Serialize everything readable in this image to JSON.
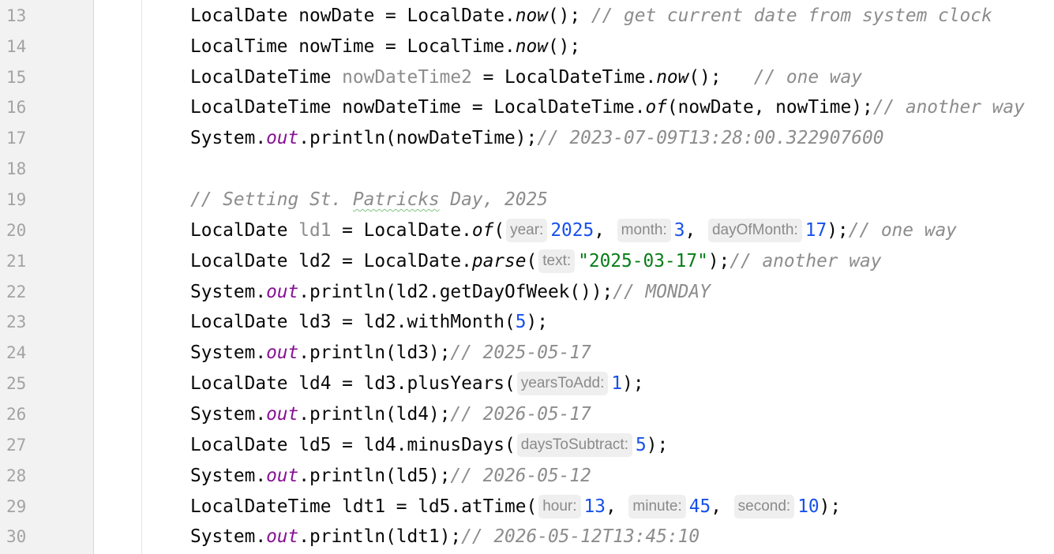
{
  "editor": {
    "colors": {
      "keyword_text": "#080808",
      "comment": "#8c8c8c",
      "string": "#067d17",
      "number": "#1750eb",
      "static_field": "#871094",
      "gutter_bg": "#f2f2f2",
      "line_number": "#a3a3a3"
    },
    "lines": [
      {
        "number": "13",
        "tokens": [
          {
            "t": "LocalDate nowDate = LocalDate."
          },
          {
            "t": "now",
            "c": "it"
          },
          {
            "t": "(); "
          },
          {
            "t": "// get current date from system clock",
            "c": "cm"
          }
        ]
      },
      {
        "number": "14",
        "tokens": [
          {
            "t": "LocalTime nowTime = LocalTime."
          },
          {
            "t": "now",
            "c": "it"
          },
          {
            "t": "();"
          }
        ]
      },
      {
        "number": "15",
        "tokens": [
          {
            "t": "LocalDateTime "
          },
          {
            "t": "nowDateTime2",
            "c": "unused"
          },
          {
            "t": " = LocalDateTime."
          },
          {
            "t": "now",
            "c": "it"
          },
          {
            "t": "();   "
          },
          {
            "t": "// one way",
            "c": "cm"
          }
        ]
      },
      {
        "number": "16",
        "tokens": [
          {
            "t": "LocalDateTime nowDateTime = LocalDateTime."
          },
          {
            "t": "of",
            "c": "it"
          },
          {
            "t": "(nowDate, nowTime);"
          },
          {
            "t": "// another way",
            "c": "cm"
          }
        ]
      },
      {
        "number": "17",
        "tokens": [
          {
            "t": "System."
          },
          {
            "t": "out",
            "c": "fld"
          },
          {
            "t": ".println(nowDateTime);"
          },
          {
            "t": "// 2023-07-09T13:28:00.322907600",
            "c": "cm"
          }
        ]
      },
      {
        "number": "18",
        "tokens": []
      },
      {
        "number": "19",
        "tokens": [
          {
            "t": "// Setting St. ",
            "c": "cm"
          },
          {
            "t": "Patricks",
            "c": "cm typo"
          },
          {
            "t": " Day, 2025",
            "c": "cm"
          }
        ]
      },
      {
        "number": "20",
        "tokens": [
          {
            "t": "LocalDate "
          },
          {
            "t": "ld1",
            "c": "unused"
          },
          {
            "t": " = LocalDate."
          },
          {
            "t": "of",
            "c": "it"
          },
          {
            "t": "("
          },
          {
            "t": "year:",
            "c": "hint"
          },
          {
            "t": "2025",
            "c": "nm"
          },
          {
            "t": ", "
          },
          {
            "t": "month:",
            "c": "hint"
          },
          {
            "t": "3",
            "c": "nm"
          },
          {
            "t": ", "
          },
          {
            "t": "dayOfMonth:",
            "c": "hint"
          },
          {
            "t": "17",
            "c": "nm"
          },
          {
            "t": ");"
          },
          {
            "t": "// one way",
            "c": "cm"
          }
        ]
      },
      {
        "number": "21",
        "tokens": [
          {
            "t": "LocalDate ld2 = LocalDate."
          },
          {
            "t": "parse",
            "c": "it"
          },
          {
            "t": "("
          },
          {
            "t": "text:",
            "c": "hint"
          },
          {
            "t": "\"2025-03-17\"",
            "c": "st"
          },
          {
            "t": ");"
          },
          {
            "t": "// another way",
            "c": "cm"
          }
        ]
      },
      {
        "number": "22",
        "tokens": [
          {
            "t": "System."
          },
          {
            "t": "out",
            "c": "fld"
          },
          {
            "t": ".println(ld2.getDayOfWeek());"
          },
          {
            "t": "// MONDAY",
            "c": "cm"
          }
        ]
      },
      {
        "number": "23",
        "tokens": [
          {
            "t": "LocalDate ld3 = ld2.withMonth("
          },
          {
            "t": "5",
            "c": "nm"
          },
          {
            "t": ");"
          }
        ]
      },
      {
        "number": "24",
        "tokens": [
          {
            "t": "System."
          },
          {
            "t": "out",
            "c": "fld"
          },
          {
            "t": ".println(ld3);"
          },
          {
            "t": "// 2025-05-17",
            "c": "cm"
          }
        ]
      },
      {
        "number": "25",
        "tokens": [
          {
            "t": "LocalDate ld4 = ld3.plusYears("
          },
          {
            "t": "yearsToAdd:",
            "c": "hint"
          },
          {
            "t": "1",
            "c": "nm"
          },
          {
            "t": ");"
          }
        ]
      },
      {
        "number": "26",
        "tokens": [
          {
            "t": "System."
          },
          {
            "t": "out",
            "c": "fld"
          },
          {
            "t": ".println(ld4);"
          },
          {
            "t": "// 2026-05-17",
            "c": "cm"
          }
        ]
      },
      {
        "number": "27",
        "tokens": [
          {
            "t": "LocalDate ld5 = ld4.minusDays("
          },
          {
            "t": "daysToSubtract:",
            "c": "hint"
          },
          {
            "t": "5",
            "c": "nm"
          },
          {
            "t": ");"
          }
        ]
      },
      {
        "number": "28",
        "tokens": [
          {
            "t": "System."
          },
          {
            "t": "out",
            "c": "fld"
          },
          {
            "t": ".println(ld5);"
          },
          {
            "t": "// 2026-05-12",
            "c": "cm"
          }
        ]
      },
      {
        "number": "29",
        "tokens": [
          {
            "t": "LocalDateTime ldt1 = ld5.atTime("
          },
          {
            "t": "hour:",
            "c": "hint"
          },
          {
            "t": "13",
            "c": "nm"
          },
          {
            "t": ", "
          },
          {
            "t": "minute:",
            "c": "hint"
          },
          {
            "t": "45",
            "c": "nm"
          },
          {
            "t": ", "
          },
          {
            "t": "second:",
            "c": "hint"
          },
          {
            "t": "10",
            "c": "nm"
          },
          {
            "t": ");"
          }
        ]
      },
      {
        "number": "30",
        "tokens": [
          {
            "t": "System."
          },
          {
            "t": "out",
            "c": "fld"
          },
          {
            "t": ".println(ldt1);"
          },
          {
            "t": "// 2026-05-12T13:45:10",
            "c": "cm"
          }
        ]
      }
    ]
  }
}
